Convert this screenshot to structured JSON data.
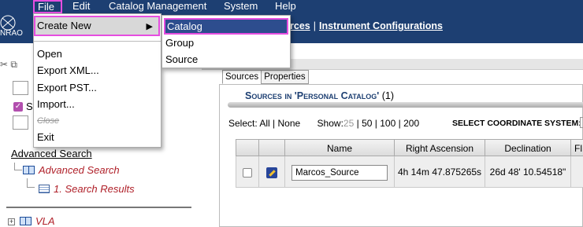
{
  "menubar": {
    "items": [
      "File",
      "Edit",
      "Catalog Management",
      "System",
      "Help"
    ]
  },
  "header": {
    "logo_text": "NRAO",
    "link_sources_partial": "rces",
    "separator": "|",
    "link_instrument": "Instrument Configurations"
  },
  "file_menu": {
    "create_new": "Create New",
    "open": "Open",
    "export_xml": "Export XML...",
    "export_pst": "Export PST...",
    "import": "Import...",
    "close": "Close",
    "exit": "Exit"
  },
  "create_submenu": {
    "catalog": "Catalog",
    "group": "Group",
    "source": "Source"
  },
  "left": {
    "checkbox_label_partial": "S",
    "advanced_search_title": "Advanced Search",
    "tree_advanced_search": "Advanced Search",
    "tree_search_results": "1. Search Results",
    "tree_vla": "VLA"
  },
  "right": {
    "tabs": [
      "Sources",
      "Properties"
    ],
    "sources_heading": "Sources in 'Personal Catalog'",
    "sources_count": "(1)",
    "select_label": "Select:",
    "select_all": "All",
    "select_sep": "|",
    "select_none": "None",
    "show_label": "Show:",
    "show_25": "25",
    "show_50": "50",
    "show_100": "100",
    "show_200": "200",
    "coord_label": "SELECT COORDINATE SYSTEM:",
    "table": {
      "headers": [
        "",
        "",
        "Name",
        "Right Ascension",
        "Declination",
        "Fl"
      ],
      "row": {
        "name": "Marcos_Source",
        "ra": "4h 14m 47.875265s",
        "dec": "26d 48' 10.54518\""
      }
    }
  },
  "colors": {
    "header_bg": "#1d3f72",
    "highlight": "#e64ee0",
    "tree_link": "#b0212a"
  }
}
